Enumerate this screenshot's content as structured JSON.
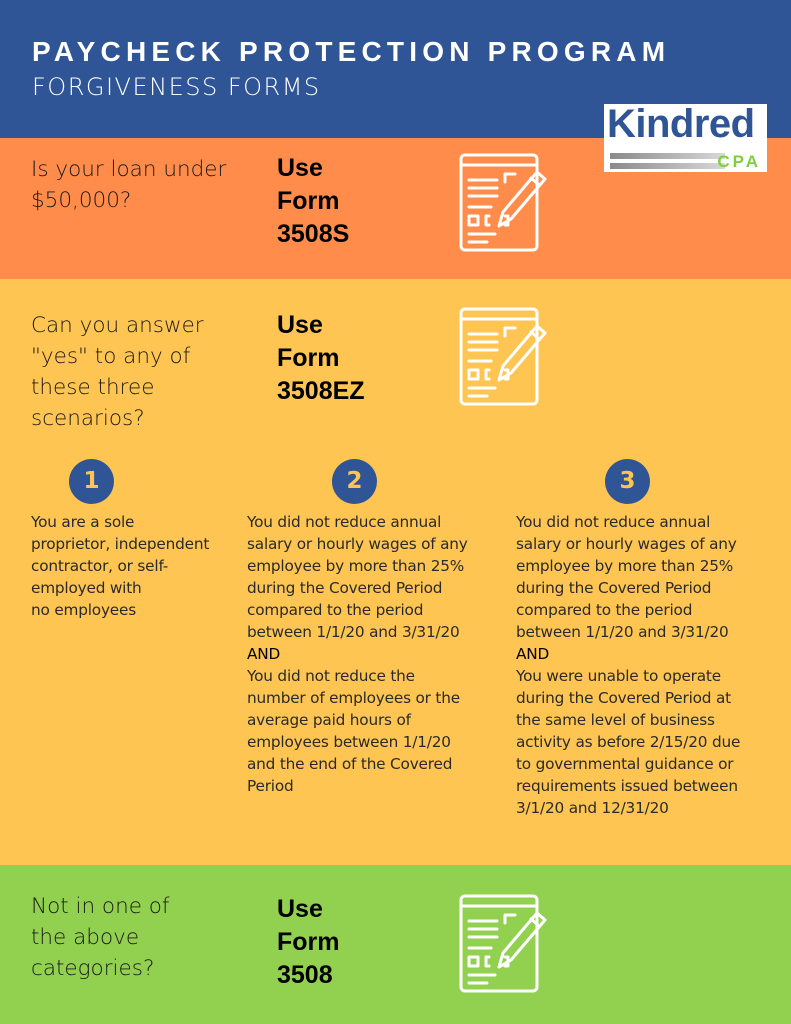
{
  "header": {
    "title": "PAYCHECK PROTECTION PROGRAM",
    "subtitle": "FORGIVENESS FORMS"
  },
  "logo": {
    "word": "Kindred",
    "tag": "CPA"
  },
  "colors": {
    "header_blue": "#2f5597",
    "orange": "#ff8c4a",
    "yellow": "#ffc553",
    "green": "#92d050",
    "logo_green": "#7fcf3f"
  },
  "sections": [
    {
      "id": "under-50k",
      "question": "Is your loan under $50,000?",
      "question_lines": [
        "Is your loan under",
        "$50,000?"
      ],
      "form_lines": [
        "Use",
        "Form",
        "3508S"
      ],
      "icon": "form-edit-icon"
    },
    {
      "id": "ez",
      "question_lines": [
        "Can you answer",
        "\"yes\" to any of",
        "these three",
        "scenarios?"
      ],
      "form_lines": [
        "Use",
        "Form",
        "3508EZ"
      ],
      "icon": "form-edit-icon",
      "scenarios": [
        {
          "number": "1",
          "lines": [
            "You are a sole",
            "proprietor, independent",
            "contractor, or self-",
            "employed with",
            "no employees"
          ]
        },
        {
          "number": "2",
          "lines": [
            "You did not reduce annual",
            "salary or hourly wages of any",
            "employee by more than 25%",
            "during the Covered Period",
            "compared to the period",
            "between 1/1/20 and 3/31/20",
            "AND",
            "You did not reduce the",
            "number of employees or the",
            "average paid hours of",
            "employees between 1/1/20",
            "and the end of the Covered",
            "Period"
          ]
        },
        {
          "number": "3",
          "lines": [
            "You did not reduce annual",
            "salary or hourly wages of any",
            "employee by more than 25%",
            "during the Covered Period",
            "compared to the period",
            "between 1/1/20 and 3/31/20",
            "AND",
            "You were unable to operate",
            "during the Covered Period at",
            "the same level of business",
            "activity as before 2/15/20 due",
            "to governmental guidance or",
            "requirements issued between",
            "3/1/20 and 12/31/20"
          ]
        }
      ]
    },
    {
      "id": "standard",
      "question_lines": [
        "Not in one of",
        "the above",
        "categories?"
      ],
      "form_lines": [
        "Use",
        "Form",
        "3508"
      ],
      "icon": "form-edit-icon"
    }
  ]
}
